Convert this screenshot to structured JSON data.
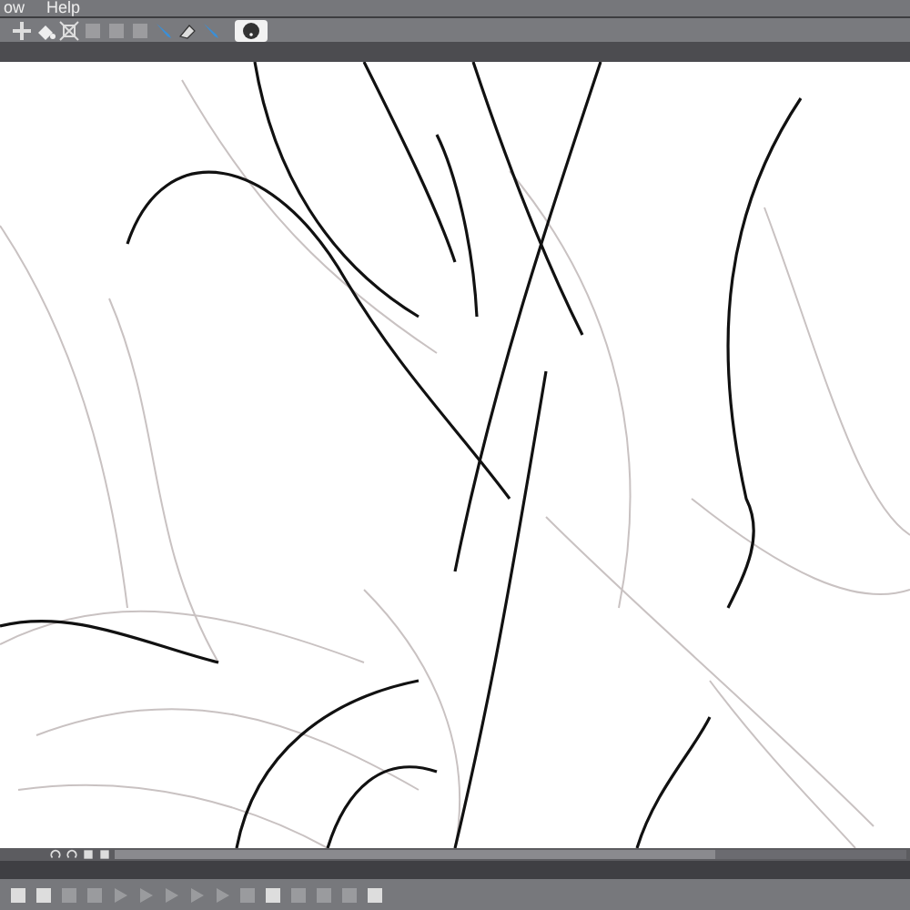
{
  "menu": [
    {
      "label": "ow"
    },
    {
      "label": "Help"
    }
  ],
  "toolbar": [
    {
      "kind": "move",
      "disabled": false
    },
    {
      "kind": "fill",
      "disabled": false
    },
    {
      "kind": "transform",
      "disabled": false
    },
    {
      "kind": "square",
      "disabled": true
    },
    {
      "kind": "square",
      "disabled": true
    },
    {
      "kind": "square",
      "disabled": true
    },
    {
      "kind": "pen",
      "disabled": false
    },
    {
      "kind": "eraser",
      "disabled": false
    },
    {
      "kind": "pen",
      "disabled": false
    },
    {
      "kind": "help",
      "disabled": false
    }
  ],
  "layer_controls": [
    {
      "kind": "undo"
    },
    {
      "kind": "redo"
    },
    {
      "kind": "square"
    },
    {
      "kind": "square"
    }
  ],
  "timeline_controls": [
    {
      "kind": "square",
      "disabled": false
    },
    {
      "kind": "square",
      "disabled": false
    },
    {
      "kind": "square",
      "disabled": true
    },
    {
      "kind": "square",
      "disabled": true
    },
    {
      "kind": "play",
      "disabled": true
    },
    {
      "kind": "play",
      "disabled": true
    },
    {
      "kind": "play",
      "disabled": true
    },
    {
      "kind": "play",
      "disabled": true
    },
    {
      "kind": "play",
      "disabled": true
    },
    {
      "kind": "square",
      "disabled": true
    },
    {
      "kind": "square",
      "disabled": false
    },
    {
      "kind": "square",
      "disabled": true
    },
    {
      "kind": "square",
      "disabled": true
    },
    {
      "kind": "square",
      "disabled": true
    },
    {
      "kind": "square",
      "disabled": false
    }
  ]
}
